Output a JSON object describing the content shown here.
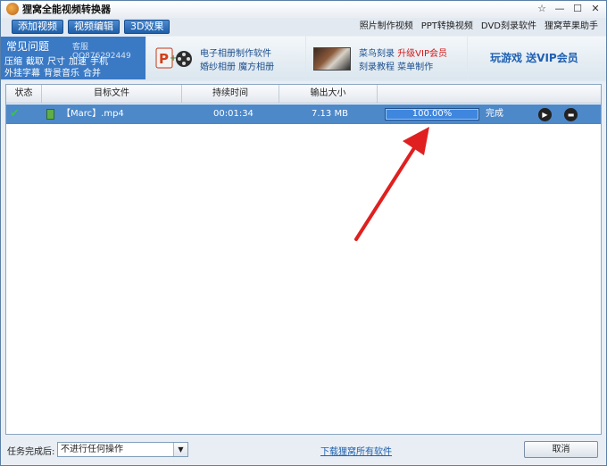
{
  "window": {
    "title": "狸窝全能视频转换器",
    "controls": {
      "menu": "☆",
      "minimize": "—",
      "maximize": "☐",
      "close": "✕"
    }
  },
  "toolbar": {
    "buttons": [
      "添加视频",
      "视频编辑",
      "3D效果"
    ],
    "links": [
      "照片制作视频",
      "PPT转换视频",
      "DVD刻录软件",
      "狸窝苹果助手"
    ]
  },
  "banner": {
    "faq": {
      "title": "常见问题",
      "service": "客服QQ876292449",
      "row1": [
        "压缩",
        "截取",
        "尺寸",
        "加速",
        "手机"
      ],
      "row2": [
        "外挂字幕",
        "背景音乐",
        "合并"
      ]
    },
    "ad1": {
      "line1": "电子相册制作软件",
      "line2": "婚纱相册  魔方相册"
    },
    "ad2": {
      "line1_a": "菜鸟刻录",
      "line1_b": "升级VIP会员",
      "line2": "刻录教程  菜单制作"
    },
    "ad3": {
      "text": "玩游戏 送VIP会员"
    }
  },
  "table": {
    "columns": [
      "状态",
      "目标文件",
      "持续时间",
      "输出大小"
    ],
    "rows": [
      {
        "status_icon": "check-icon",
        "file": "【Marc】.mp4",
        "duration": "00:01:34",
        "size": "7.13 MB",
        "progress": "100.00%",
        "state": "完成"
      }
    ]
  },
  "footer": {
    "after_label": "任务完成后:",
    "after_value": "不进行任何操作",
    "download_link": "下载狸窝所有软件",
    "cancel": "取消"
  },
  "colors": {
    "accent": "#3a79c4",
    "selected_row": "#4d88c9",
    "arrow": "#e02020"
  }
}
